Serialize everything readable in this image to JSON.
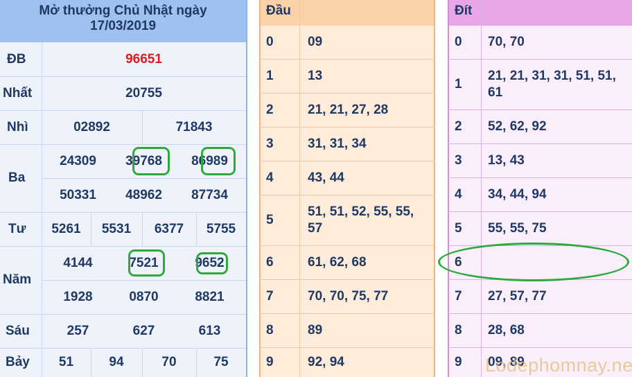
{
  "result": {
    "title_line1": "Mở thưởng Chủ Nhật ngày",
    "title_line2": "17/03/2019",
    "prizes": {
      "db": {
        "label": "ĐB",
        "values": [
          "96651"
        ]
      },
      "nhat": {
        "label": "Nhất",
        "values": [
          "20755"
        ]
      },
      "nhi": {
        "label": "Nhì",
        "values": [
          "02892",
          "71843"
        ]
      },
      "ba": {
        "label": "Ba",
        "values": [
          "24309",
          "39768",
          "86989",
          "50331",
          "48962",
          "87734"
        ]
      },
      "tu": {
        "label": "Tư",
        "values": [
          "5261",
          "5531",
          "6377",
          "5755"
        ]
      },
      "nam": {
        "label": "Năm",
        "values": [
          "4144",
          "7521",
          "9652",
          "1928",
          "0870",
          "8821"
        ]
      },
      "sau": {
        "label": "Sáu",
        "values": [
          "257",
          "627",
          "613"
        ]
      },
      "bay": {
        "label": "Bảy",
        "values": [
          "51",
          "94",
          "70",
          "75"
        ]
      }
    }
  },
  "dau": {
    "header": "Đầu",
    "rows": [
      {
        "digit": "0",
        "values": "09"
      },
      {
        "digit": "1",
        "values": "13"
      },
      {
        "digit": "2",
        "values": "21, 21, 27, 28"
      },
      {
        "digit": "3",
        "values": "31, 31, 34"
      },
      {
        "digit": "4",
        "values": "43, 44"
      },
      {
        "digit": "5",
        "values": "51, 51, 52, 55, 55,",
        "values2": "57"
      },
      {
        "digit": "6",
        "values": "61, 62, 68"
      },
      {
        "digit": "7",
        "values": "70, 70, 75, 77"
      },
      {
        "digit": "8",
        "values": "89"
      },
      {
        "digit": "9",
        "values": "92, 94"
      }
    ]
  },
  "dit": {
    "header": "Đít",
    "rows": [
      {
        "digit": "0",
        "values": "70, 70"
      },
      {
        "digit": "1",
        "values": "21, 21, 31, 31, 51, 51,",
        "values2": "61"
      },
      {
        "digit": "2",
        "values": "52, 62, 92"
      },
      {
        "digit": "3",
        "values": "13, 43"
      },
      {
        "digit": "4",
        "values": "34, 44, 94"
      },
      {
        "digit": "5",
        "values": "55, 55, 75"
      },
      {
        "digit": "6",
        "values": ""
      },
      {
        "digit": "7",
        "values": "27, 57, 77"
      },
      {
        "digit": "8",
        "values": "28, 68"
      },
      {
        "digit": "9",
        "values": "09, 89"
      }
    ]
  },
  "watermark": "Lodephomnay.net",
  "colors": {
    "result_header": "#9fc1f0",
    "dau_bg": "#fdecd9",
    "dit_bg": "#fbeefb",
    "dit_header": "#e8a6e8",
    "highlight": "#2eaa3d",
    "special_prize": "#e01b1b"
  }
}
